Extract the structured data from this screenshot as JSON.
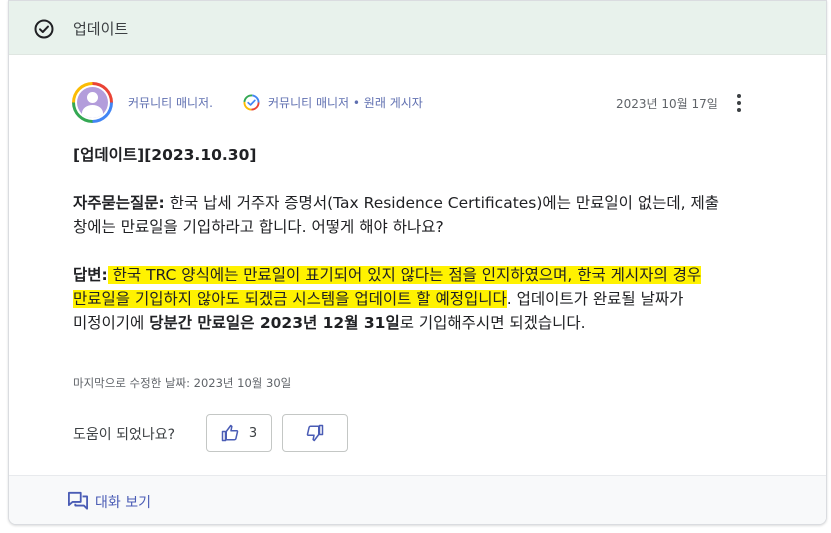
{
  "banner": {
    "title": "업데이트",
    "icon": "check-circle-icon"
  },
  "author": {
    "name": "커뮤니티 매니저.",
    "role": "커뮤니티 매니저 • 원래 게시자",
    "badge_icon": "verified-badge-icon",
    "date": "2023년 10월 17일"
  },
  "post": {
    "heading": "[업데이트][2023.10.30]",
    "faq_label": "자주묻는질문:",
    "faq_text_1": " 한국 납세 거주자 증명서(Tax Residence Certificates)에는 만료일이 없는데, 제출",
    "faq_text_2": "창에는 만료일을 기입하라고 합니다. 어떻게 해야 하나요?",
    "answer_label": "답변:",
    "answer_hl_1": " 한국 TRC 양식에는 만료일이 표기되어 있지 않다는 점을 인지하였으며, 한국 게시자의 경우",
    "answer_hl_2": "만료일을 기입하지 않아도 되겠금 시스템을 업데이트 할 예정입니다",
    "answer_text_2": ". 업데이트가 완료될 날짜가",
    "answer_text_3": "미정이기에 ",
    "answer_bold_3": "당분간 만료일은 2023년 12월 31일",
    "answer_text_3b": "로 기입해주시면 되겠습니다."
  },
  "edited": "마지막으로 수정한 날짜: 2023년 10월 30일",
  "feedback": {
    "question": "도움이 되었나요?",
    "upvote_count": "3",
    "upvote_icon": "thumbs-up-icon",
    "downvote_icon": "thumbs-down-icon"
  },
  "footer": {
    "label": "대화 보기",
    "icon": "chat-icon"
  },
  "colors": {
    "banner_bg": "#e8f2ec",
    "highlight": "#fff200",
    "link": "#4a5cb5"
  }
}
